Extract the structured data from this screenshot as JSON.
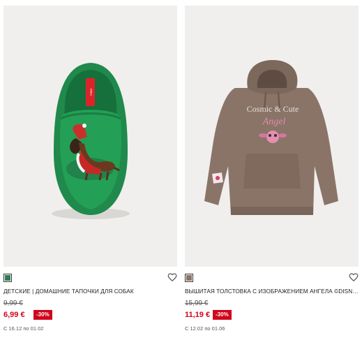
{
  "products": [
    {
      "image_alt": "dog-slipper-icon",
      "swatch_color": "#2e7d56",
      "title": "ДЕТСКИЕ | ДОМАШНИЕ ТАПОЧКИ ДЛЯ СОБАК",
      "old_price": "9,99 €",
      "new_price": "6,99 €",
      "discount": "-30%",
      "dates": "С 16.12 по 01.02",
      "slipper_tag": "lefties"
    },
    {
      "image_alt": "hoodie-icon",
      "swatch_color": "#8a7468",
      "title": "ВЫШИТАЯ ТОЛСТОВКА С ИЗОБРАЖЕНИЕМ АНГЕЛА ©DISNEY",
      "old_price": "15,99 €",
      "new_price": "11,19 €",
      "discount": "-30%",
      "dates": "С 12.02 по 01.06",
      "print_line1": "Cosmic & Cute",
      "print_line2": "Angel"
    }
  ]
}
